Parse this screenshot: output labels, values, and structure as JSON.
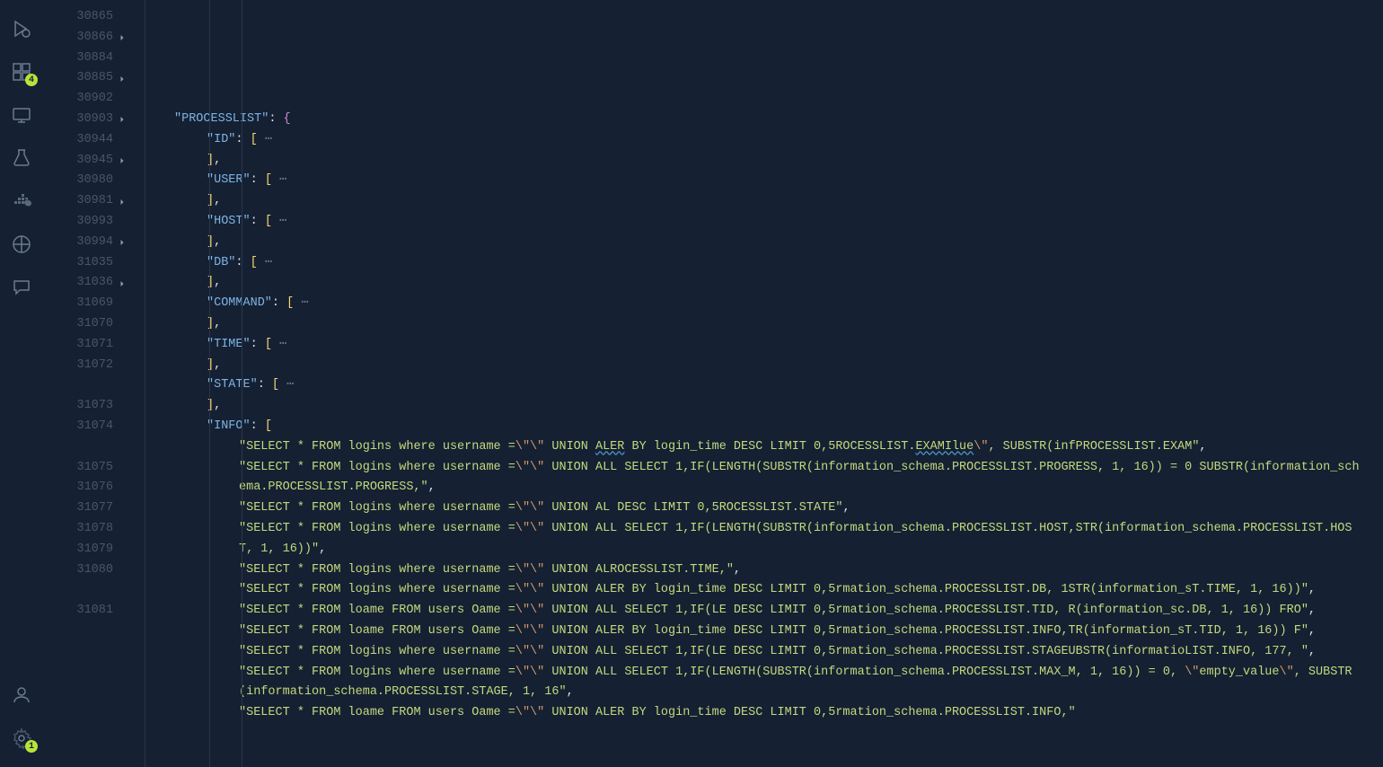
{
  "activity_bar": {
    "icons": [
      {
        "name": "run-debug-icon"
      },
      {
        "name": "extensions-icon",
        "badge": "4"
      },
      {
        "name": "remote-explorer-icon"
      },
      {
        "name": "testing-icon"
      },
      {
        "name": "docker-icon"
      },
      {
        "name": "kubernetes-icon"
      },
      {
        "name": "comments-icon"
      }
    ],
    "bottom_icons": [
      {
        "name": "accounts-icon"
      },
      {
        "name": "settings-icon",
        "badge": "1"
      }
    ]
  },
  "editor": {
    "line_start": 30865,
    "lines": [
      {
        "num": "30865",
        "fold": false,
        "indent": 12,
        "type": "key-brace",
        "key": "PROCESSLIST",
        "suffix": ": {"
      },
      {
        "num": "30866",
        "fold": true,
        "indent": 24,
        "type": "key-array-fold",
        "key": "ID"
      },
      {
        "num": "30884",
        "fold": false,
        "indent": 24,
        "type": "close-array"
      },
      {
        "num": "30885",
        "fold": true,
        "indent": 24,
        "type": "key-array-fold",
        "key": "USER"
      },
      {
        "num": "30902",
        "fold": false,
        "indent": 24,
        "type": "close-array"
      },
      {
        "num": "30903",
        "fold": true,
        "indent": 24,
        "type": "key-array-fold",
        "key": "HOST"
      },
      {
        "num": "30944",
        "fold": false,
        "indent": 24,
        "type": "close-array"
      },
      {
        "num": "30945",
        "fold": true,
        "indent": 24,
        "type": "key-array-fold",
        "key": "DB"
      },
      {
        "num": "30980",
        "fold": false,
        "indent": 24,
        "type": "close-array"
      },
      {
        "num": "30981",
        "fold": true,
        "indent": 24,
        "type": "key-array-fold",
        "key": "COMMAND"
      },
      {
        "num": "30993",
        "fold": false,
        "indent": 24,
        "type": "close-array"
      },
      {
        "num": "30994",
        "fold": true,
        "indent": 24,
        "type": "key-array-fold",
        "key": "TIME"
      },
      {
        "num": "31035",
        "fold": false,
        "indent": 24,
        "type": "close-array"
      },
      {
        "num": "31036",
        "fold": true,
        "indent": 24,
        "type": "key-array-fold",
        "key": "STATE"
      },
      {
        "num": "31069",
        "fold": false,
        "indent": 24,
        "type": "close-array"
      },
      {
        "num": "31070",
        "fold": false,
        "indent": 24,
        "type": "key-array-open",
        "key": "INFO"
      },
      {
        "num": "31071",
        "fold": false,
        "indent": 36,
        "type": "string-entry",
        "parts": [
          {
            "t": "SELECT * FROM logins where username =",
            "c": "str"
          },
          {
            "t": "\\\"\\\"",
            "c": "esc"
          },
          {
            "t": " UNION ",
            "c": "str"
          },
          {
            "t": "ALER",
            "c": "str",
            "wavy": true
          },
          {
            "t": " BY login_time DESC LIMIT 0,5ROCESSLIST.",
            "c": "str"
          },
          {
            "t": "EXAMIlue",
            "c": "str",
            "wavy": true
          },
          {
            "t": "\\\"",
            "c": "esc"
          },
          {
            "t": ", SUBSTR(infPROCESSLIST.EXAM",
            "c": "str"
          }
        ],
        "comma": true
      },
      {
        "num": "31072",
        "fold": false,
        "indent": 36,
        "type": "string-entry",
        "parts": [
          {
            "t": "SELECT * FROM logins where username =",
            "c": "str"
          },
          {
            "t": "\\\"\\\"",
            "c": "esc"
          },
          {
            "t": " UNION ALL SELECT 1,IF(LENGTH(SUBSTR(information_schema.PROCESSLIST.PROGRESS, 1, 16)) = 0 SUBSTR(information_schema.PROCESSLIST.PROGRESS,",
            "c": "str"
          }
        ],
        "comma": true
      },
      {
        "num": "31073",
        "fold": false,
        "indent": 36,
        "type": "string-entry",
        "parts": [
          {
            "t": "SELECT * FROM logins where username =",
            "c": "str"
          },
          {
            "t": "\\\"\\\"",
            "c": "esc"
          },
          {
            "t": " UNION AL DESC LIMIT 0,5ROCESSLIST.STATE",
            "c": "str"
          }
        ],
        "comma": true
      },
      {
        "num": "31074",
        "fold": false,
        "indent": 36,
        "type": "string-entry",
        "parts": [
          {
            "t": "SELECT * FROM logins where username =",
            "c": "str"
          },
          {
            "t": "\\\"\\\"",
            "c": "esc"
          },
          {
            "t": " UNION ALL SELECT 1,IF(LENGTH(SUBSTR(information_schema.PROCESSLIST.HOST,STR(information_schema.PROCESSLIST.HOST, 1, 16))",
            "c": "str"
          }
        ],
        "comma": true
      },
      {
        "num": "31075",
        "fold": false,
        "indent": 36,
        "type": "string-entry",
        "parts": [
          {
            "t": "SELECT * FROM logins where username =",
            "c": "str"
          },
          {
            "t": "\\\"\\\"",
            "c": "esc"
          },
          {
            "t": " UNION ALROCESSLIST.TIME,",
            "c": "str"
          }
        ],
        "comma": true
      },
      {
        "num": "31076",
        "fold": false,
        "indent": 36,
        "type": "string-entry",
        "parts": [
          {
            "t": "SELECT * FROM logins where username =",
            "c": "str"
          },
          {
            "t": "\\\"\\\"",
            "c": "esc"
          },
          {
            "t": " UNION ALER BY login_time DESC LIMIT 0,5rmation_schema.PROCESSLIST.DB, 1STR(information_sT.TIME, 1, 16))",
            "c": "str"
          }
        ],
        "comma": true
      },
      {
        "num": "31077",
        "fold": false,
        "indent": 36,
        "type": "string-entry",
        "parts": [
          {
            "t": "SELECT * FROM loame FROM users Oame =",
            "c": "str"
          },
          {
            "t": "\\\"\\\"",
            "c": "esc"
          },
          {
            "t": " UNION ALL SELECT 1,IF(LE DESC LIMIT 0,5rmation_schema.PROCESSLIST.TID, R(information_sc.DB, 1, 16)) FRO",
            "c": "str"
          }
        ],
        "comma": true
      },
      {
        "num": "31078",
        "fold": false,
        "indent": 36,
        "type": "string-entry",
        "parts": [
          {
            "t": "SELECT * FROM loame FROM users Oame =",
            "c": "str"
          },
          {
            "t": "\\\"\\\"",
            "c": "esc"
          },
          {
            "t": " UNION ALER BY login_time DESC LIMIT 0,5rmation_schema.PROCESSLIST.INFO,TR(information_sT.TID, 1, 16)) F",
            "c": "str"
          }
        ],
        "comma": true
      },
      {
        "num": "31079",
        "fold": false,
        "indent": 36,
        "type": "string-entry",
        "parts": [
          {
            "t": "SELECT * FROM logins where username =",
            "c": "str"
          },
          {
            "t": "\\\"\\\"",
            "c": "esc"
          },
          {
            "t": " UNION ALL SELECT 1,IF(LE DESC LIMIT 0,5rmation_schema.PROCESSLIST.STAGEUBSTR(informatioLIST.INFO, 177, ",
            "c": "str"
          }
        ],
        "comma": true
      },
      {
        "num": "31080",
        "fold": false,
        "indent": 36,
        "type": "string-entry",
        "parts": [
          {
            "t": "SELECT * FROM logins where username =",
            "c": "str"
          },
          {
            "t": "\\\"\\\"",
            "c": "esc"
          },
          {
            "t": " UNION ALL SELECT 1,IF(LENGTH(SUBSTR(information_schema.PROCESSLIST.MAX_M, 1, 16)) = 0, ",
            "c": "str"
          },
          {
            "t": "\\\"",
            "c": "esc"
          },
          {
            "t": "empty_value",
            "c": "str"
          },
          {
            "t": "\\\"",
            "c": "esc"
          },
          {
            "t": ", SUBSTR(information_schema.PROCESSLIST.STAGE, 1, 16",
            "c": "str"
          }
        ],
        "comma": true
      },
      {
        "num": "31081",
        "fold": false,
        "indent": 36,
        "type": "string-entry",
        "parts": [
          {
            "t": "SELECT * FROM loame FROM users Oame =",
            "c": "str"
          },
          {
            "t": "\\\"\\\"",
            "c": "esc"
          },
          {
            "t": " UNION ALER BY login_time DESC LIMIT 0,5rmation_schema.PROCESSLIST.INFO,",
            "c": "str"
          }
        ],
        "comma": false
      }
    ]
  }
}
